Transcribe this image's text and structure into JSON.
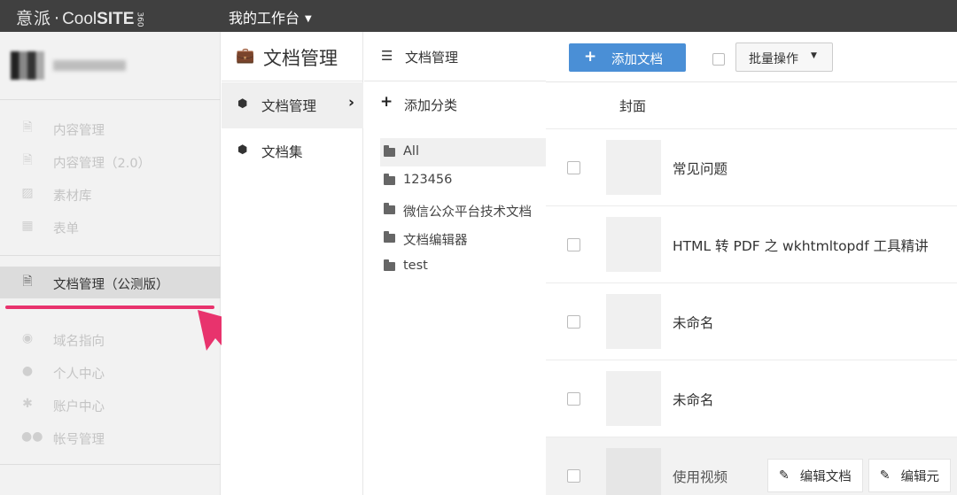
{
  "topbar": {
    "logo_cn": "意派",
    "logo_dot": "·",
    "logo_cool": "Cool",
    "logo_site": "SITE",
    "logo_360": "360",
    "workspace_label": "我的工作台"
  },
  "sidebar": {
    "items_top": [
      {
        "label": "内容管理",
        "icon": "file-icon"
      },
      {
        "label": "内容管理（2.0）",
        "icon": "file-icon"
      },
      {
        "label": "素材库",
        "icon": "image-icon"
      },
      {
        "label": "表单",
        "icon": "table-icon"
      }
    ],
    "active_item": {
      "label": "文档管理（公测版）",
      "icon": "file-icon"
    },
    "items_bottom": [
      {
        "label": "域名指向",
        "icon": "globe-icon"
      },
      {
        "label": "个人中心",
        "icon": "user-icon"
      },
      {
        "label": "账户中心",
        "icon": "gear-icon"
      },
      {
        "label": "帐号管理",
        "icon": "users-icon"
      }
    ]
  },
  "module_nav": {
    "title": "文档管理",
    "items": [
      {
        "label": "文档管理",
        "active": true
      },
      {
        "label": "文档集",
        "active": false
      }
    ]
  },
  "categories": {
    "title": "文档管理",
    "add_label": "添加分类",
    "items": [
      "All",
      "123456",
      "微信公众平台技术文档",
      "文档编辑器",
      "test"
    ]
  },
  "main": {
    "add_doc_label": "添加文档",
    "bulk_label": "批量操作",
    "cover_header": "封面",
    "documents": [
      {
        "title": "常见问题"
      },
      {
        "title": "HTML 转 PDF 之 wkhtmltopdf 工具精讲"
      },
      {
        "title": "未命名"
      },
      {
        "title": "未命名"
      },
      {
        "title": "使用视频"
      }
    ],
    "row_actions": [
      "编辑文档",
      "编辑元"
    ]
  },
  "colors": {
    "topbar": "#404040",
    "primary_button": "#4a8fd6",
    "annotation": "#e8336d"
  }
}
